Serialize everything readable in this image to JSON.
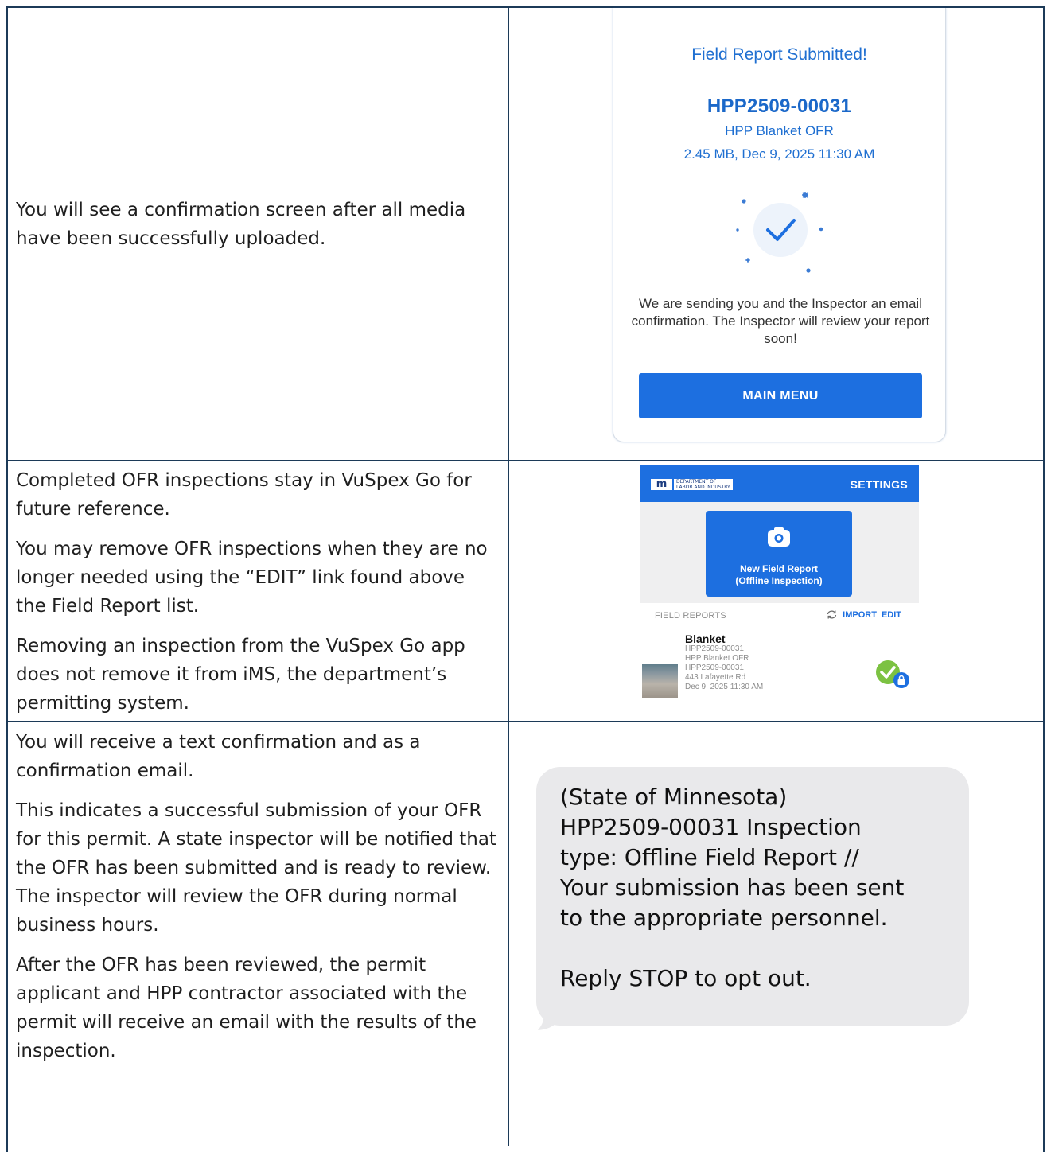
{
  "rows": [
    {
      "paragraphs": [
        "You will see a confirmation screen after all media have been successfully uploaded."
      ]
    },
    {
      "paragraphs": [
        "Completed OFR inspections stay in VuSpex Go for future reference.",
        "You may remove OFR inspections when they are no longer needed using the “EDIT” link found above the Field Report list.",
        "Removing an inspection from the VuSpex Go app does not remove it from iMS, the department’s permitting system."
      ]
    },
    {
      "paragraphs": [
        "You will receive a text confirmation and as a confirmation email.",
        "This indicates a successful submission of your OFR for this permit. A state inspector will be notified that the OFR has been submitted and is ready to review. The inspector will review the OFR during normal business hours.",
        "After the OFR has been reviewed, the permit applicant and HPP contractor associated with the permit will receive an email with the results of the inspection."
      ]
    }
  ],
  "confirmation": {
    "title": "Field Report Submitted!",
    "report_id": "HPP2509-00031",
    "report_type": "HPP Blanket OFR",
    "meta": "2.45 MB, Dec 9, 2025 11:30 AM",
    "message": "We are sending you and the Inspector an email confirmation. The Inspector will review your report soon!",
    "main_menu_label": "MAIN MENU",
    "check_icon": "checkmark-icon"
  },
  "app": {
    "logo_letters": "m",
    "logo_text_line1": "DEPARTMENT OF",
    "logo_text_line2": "LABOR AND INDUSTRY",
    "settings_label": "SETTINGS",
    "new_report_line1": "New Field Report",
    "new_report_line2": "(Offline Inspection)",
    "field_reports_label": "FIELD REPORTS",
    "import_label": "IMPORT",
    "edit_label": "EDIT",
    "item": {
      "name": "Blanket",
      "lines": [
        "HPP2509-00031",
        "HPP Blanket OFR",
        "HPP2509-00031",
        "443 Lafayette Rd",
        "Dec 9, 2025 11:30 AM"
      ]
    },
    "colors": {
      "header": "#1d6fe0",
      "success": "#7cc242"
    }
  },
  "sms": {
    "lines": [
      "(State of Minnesota)",
      "HPP2509-00031 Inspection",
      "type: Offline Field Report //",
      "Your submission has been sent",
      "to the appropriate personnel."
    ],
    "footer": "Reply STOP to opt out."
  }
}
